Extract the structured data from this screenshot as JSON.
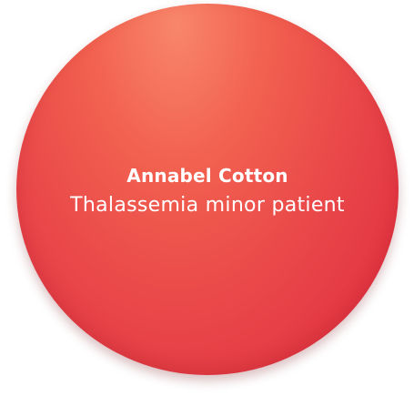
{
  "patient": {
    "name": "Annabel Cotton",
    "description": "Thalassemia minor patient"
  },
  "colors": {
    "bubble_highlight": "#f8866a",
    "bubble_mid": "#ea4a4a",
    "bubble_edge": "#e02a3e",
    "text": "#ffffff"
  }
}
